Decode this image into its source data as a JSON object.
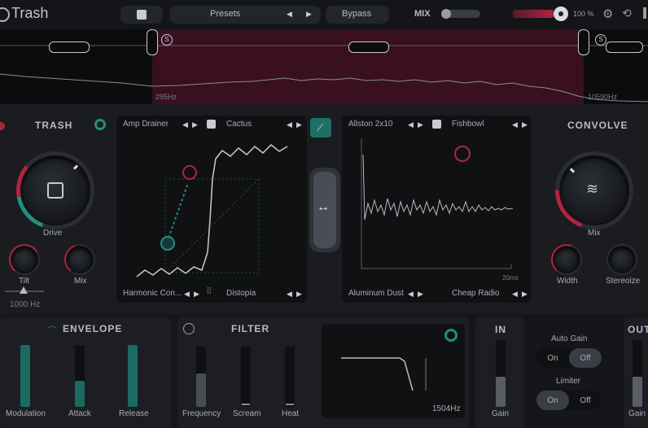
{
  "header": {
    "app_title": "Trash",
    "presets_label": "Presets",
    "bypass_label": "Bypass",
    "mix_label": "MIX",
    "output_level": "100 %"
  },
  "spectrum": {
    "low_freq": "295Hz",
    "high_freq": "10590Hz"
  },
  "trash": {
    "title": "TRASH",
    "drive_label": "Drive",
    "tilt_label": "Tilt",
    "mix_label": "Mix",
    "tilt_freq": "1000 Hz"
  },
  "distortion": {
    "slot_a_name": "Amp Drainer",
    "slot_b_name": "Cactus",
    "slot_c_name": "Harmonic Con...",
    "slot_d_name": "Distopia"
  },
  "convolve": {
    "title": "CONVOLVE",
    "slot_a_name": "Allston 2x10",
    "slot_b_name": "Fishbowl",
    "slot_c_name": "Aluminum Dust",
    "slot_d_name": "Cheap Radio",
    "ir_length": "20ms",
    "mix_label": "Mix",
    "width_label": "Width",
    "stereoize_label": "Stereoize"
  },
  "envelope": {
    "title": "ENVELOPE",
    "modulation_label": "Modulation",
    "attack_label": "Attack",
    "release_label": "Release",
    "modulation_level": 1.0,
    "attack_level": 0.42,
    "release_level": 1.0
  },
  "filter": {
    "title": "FILTER",
    "frequency_label": "Frequency",
    "scream_label": "Scream",
    "heat_label": "Heat",
    "cutoff_readout": "1504Hz",
    "frequency_level": 0.55
  },
  "input": {
    "title": "IN",
    "gain_label": "Gain"
  },
  "output": {
    "title": "OUT",
    "gain_label": "Gain"
  },
  "auto_gain": {
    "title": "Auto Gain",
    "on_label": "On",
    "off_label": "Off",
    "state": "Off"
  },
  "limiter": {
    "title": "Limiter",
    "on_label": "On",
    "off_label": "Off",
    "state": "On"
  },
  "colors": {
    "accent_teal": "#1f8f80",
    "accent_red": "#b0243f",
    "band_fill": "#4a1427"
  }
}
